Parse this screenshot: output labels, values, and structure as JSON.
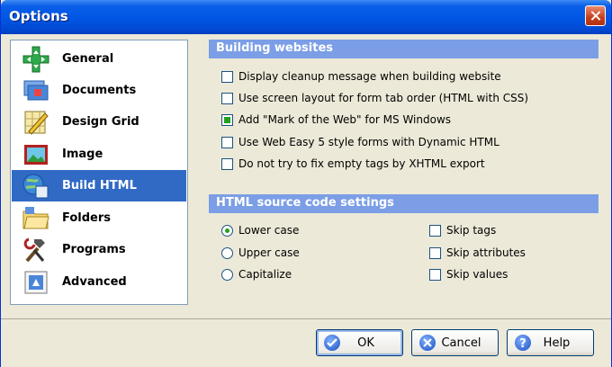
{
  "window": {
    "title": "Options"
  },
  "nav": {
    "items": [
      {
        "label": "General",
        "icon": "general-icon"
      },
      {
        "label": "Documents",
        "icon": "documents-icon"
      },
      {
        "label": "Design Grid",
        "icon": "design-grid-icon"
      },
      {
        "label": "Image",
        "icon": "image-icon"
      },
      {
        "label": "Build HTML",
        "icon": "build-html-icon",
        "selected": true
      },
      {
        "label": "Folders",
        "icon": "folders-icon"
      },
      {
        "label": "Programs",
        "icon": "programs-icon"
      },
      {
        "label": "Advanced",
        "icon": "advanced-icon"
      }
    ]
  },
  "building": {
    "header": "Building websites",
    "options": [
      {
        "label": "Display cleanup message when building website",
        "checked": false
      },
      {
        "label": "Use screen layout for form tab order (HTML with CSS)",
        "checked": false
      },
      {
        "label": "Add \"Mark of the Web\" for MS Windows",
        "checked": true
      },
      {
        "label": "Use Web Easy 5 style forms with Dynamic HTML",
        "checked": false
      },
      {
        "label": "Do not try to fix empty tags by XHTML export",
        "checked": false
      }
    ]
  },
  "source": {
    "header": "HTML source code settings",
    "case_options": [
      {
        "label": "Lower case",
        "checked": true
      },
      {
        "label": "Upper case",
        "checked": false
      },
      {
        "label": "Capitalize",
        "checked": false
      }
    ],
    "skip_options": [
      {
        "label": "Skip tags",
        "checked": false
      },
      {
        "label": "Skip attributes",
        "checked": false
      },
      {
        "label": "Skip values",
        "checked": false
      }
    ]
  },
  "buttons": {
    "ok": "OK",
    "cancel": "Cancel",
    "help": "Help"
  },
  "colors": {
    "titlebar": "#0056e4",
    "selection": "#316ac5",
    "section_header": "#7b9ee6",
    "check": "#21a121"
  }
}
